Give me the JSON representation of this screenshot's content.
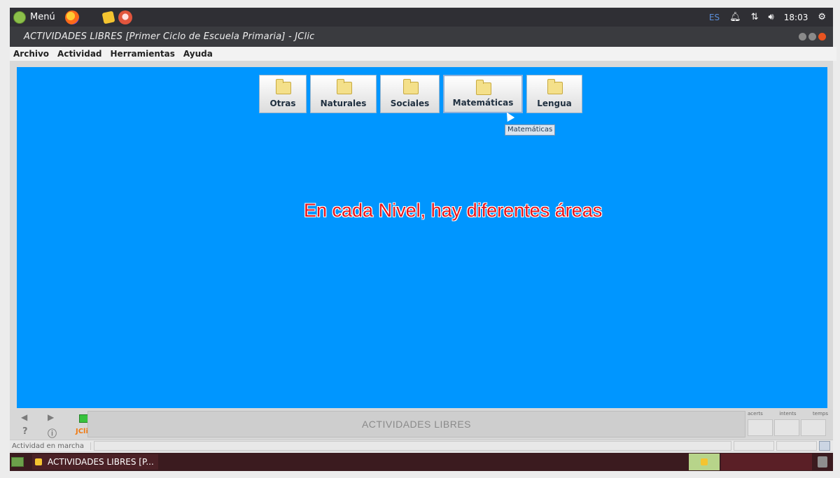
{
  "panel": {
    "menu_label": "Menú",
    "language": "ES",
    "time": "18:03",
    "icons": [
      "menu-icon",
      "firefox-icon",
      "folder-icon",
      "media-icon",
      "bell-icon",
      "network-icon",
      "volume-icon",
      "settings-icon"
    ]
  },
  "window": {
    "title": "ACTIVIDADES LIBRES [Primer Ciclo de Escuela Primaria] - JClic",
    "close_color": "#e95420"
  },
  "menubar": {
    "items": [
      "Archivo",
      "Actividad",
      "Herramientas",
      "Ayuda"
    ]
  },
  "canvas": {
    "background": "#0096ff",
    "tabs": [
      "Otras",
      "Naturales",
      "Sociales",
      "Matemáticas",
      "Lengua"
    ],
    "active_tab": "Matemáticas",
    "tooltip": "Matemáticas",
    "overlay_text": "En cada Nivel, hay diferentes áreas",
    "overlay_color": "#e8161b"
  },
  "controls": {
    "logo": "JClic",
    "status_title": "ACTIVIDADES LIBRES",
    "counters": [
      "acerts",
      "intents",
      "temps"
    ],
    "counter_values": [
      "",
      "",
      ""
    ]
  },
  "statusbar": {
    "text": "Actividad en marcha"
  },
  "taskbar": {
    "task_label": "ACTIVIDADES LIBRES [P..."
  }
}
